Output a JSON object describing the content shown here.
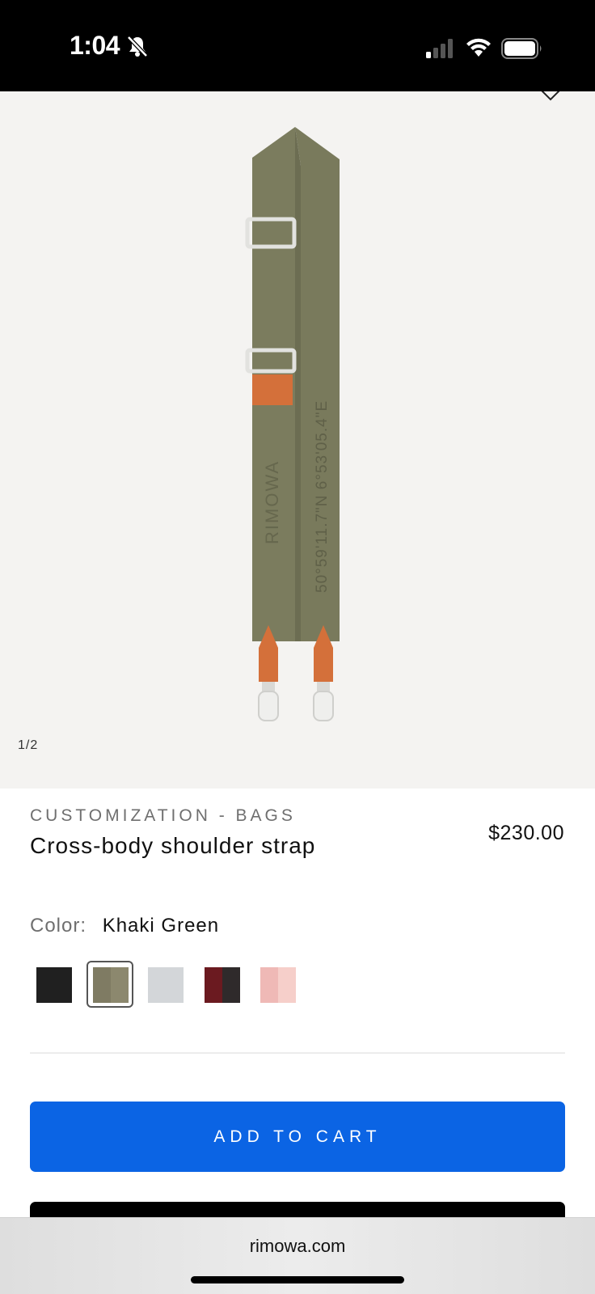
{
  "status_bar": {
    "time": "1:04",
    "icons": [
      "bell-slash-icon",
      "cellular-signal-icon",
      "wifi-icon",
      "battery-icon"
    ]
  },
  "gallery": {
    "counter": "1/2",
    "icons": [
      "wishlist-heart-icon"
    ],
    "image": {
      "brand_text": "RIMOWA",
      "coordinates_text": "50°59'11.7\"N 6°53'05.4\"E",
      "colors": {
        "strap": "#7b7c5e",
        "leather": "#d4703a",
        "hardware": "#e8e8e6",
        "background": "#f4f3f1"
      }
    }
  },
  "product": {
    "category": "CUSTOMIZATION - BAGS",
    "title": "Cross-body shoulder strap",
    "price": "$230.00",
    "color_label": "Color:",
    "color_value": "Khaki Green",
    "swatches": [
      {
        "name": "Black",
        "colors": [
          "#202020",
          "#202020"
        ],
        "selected": false
      },
      {
        "name": "Khaki Green",
        "colors": [
          "#7f7b63",
          "#8c886e"
        ],
        "selected": true
      },
      {
        "name": "Light Grey",
        "colors": [
          "#d3d6d9",
          "#d3d6d9"
        ],
        "selected": false
      },
      {
        "name": "Red",
        "colors": [
          "#6b1a20",
          "#2f2a2b"
        ],
        "selected": false
      },
      {
        "name": "Pink",
        "colors": [
          "#efb9b6",
          "#f6cfca"
        ],
        "selected": false
      }
    ]
  },
  "actions": {
    "add_to_cart": "ADD TO CART",
    "accent_color": "#0b64e4"
  },
  "browser": {
    "url": "rimowa.com"
  }
}
